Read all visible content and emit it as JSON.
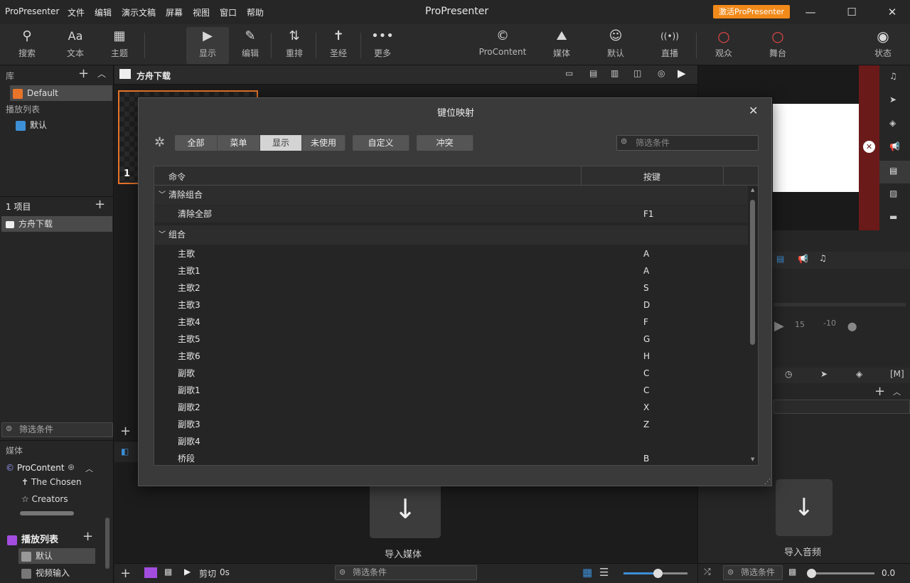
{
  "app": {
    "name": "ProPresenter",
    "title": "ProPresenter",
    "menu": [
      "文件",
      "编辑",
      "演示文稿",
      "屏幕",
      "视图",
      "窗口",
      "帮助"
    ],
    "activate_label": "激活ProPresenter"
  },
  "toolbar": {
    "left": [
      {
        "icon": "search-icon",
        "glyph": "🔍",
        "label": "搜索"
      },
      {
        "icon": "text-icon",
        "glyph": "Aa",
        "label": "文本"
      },
      {
        "icon": "theme-icon",
        "glyph": "▦",
        "label": "主题"
      }
    ],
    "mid": [
      {
        "icon": "play-icon",
        "glyph": "▶",
        "label": "显示"
      },
      {
        "icon": "edit-icon",
        "glyph": "✎",
        "label": "编辑"
      },
      {
        "icon": "reflow-icon",
        "glyph": "⇅",
        "label": "重排"
      },
      {
        "icon": "bible-icon",
        "glyph": "✝",
        "label": "圣经"
      },
      {
        "icon": "more-icon",
        "glyph": "•••",
        "label": "更多"
      }
    ],
    "right": [
      {
        "icon": "procontent-icon",
        "glyph": "©",
        "label": "ProContent"
      },
      {
        "icon": "media-icon",
        "glyph": "⛰",
        "label": "媒体"
      },
      {
        "icon": "default-icon",
        "glyph": "☺",
        "label": "默认"
      },
      {
        "icon": "live-icon",
        "glyph": "((•))",
        "label": "直播"
      },
      {
        "icon": "audience-icon",
        "glyph": "○",
        "label": "观众"
      },
      {
        "icon": "stage-icon",
        "glyph": "○",
        "label": "舞台"
      },
      {
        "icon": "status-icon",
        "glyph": "◉",
        "label": "状态"
      }
    ]
  },
  "library": {
    "title": "库",
    "item": "Default",
    "playlist_title": "播放列表",
    "playlist_item": "默认"
  },
  "items": {
    "title": "1 项目",
    "item": "方舟下载"
  },
  "left_filter": "筛选条件",
  "media": {
    "title": "媒体",
    "procontent": "ProContent",
    "sub": [
      "The Chosen",
      "Creators"
    ],
    "playlist_title": "播放列表",
    "playlist_items": [
      "默认",
      "视频输入"
    ]
  },
  "center": {
    "doc_title": "方舟下载",
    "slide_num": "1",
    "import_media": "导入媒体",
    "cut_label": "剪切",
    "cut_time": "0s",
    "filter": "筛选条件"
  },
  "right": {
    "import_audio": "导入音频",
    "filter": "筛选条件",
    "volume": "0.0",
    "skip_fwd": "15",
    "skip_back": "-10"
  },
  "dialog": {
    "title": "键位映射",
    "tabs": [
      "全部",
      "菜单",
      "显示",
      "未使用"
    ],
    "selected_tab": "显示",
    "custom": "自定义",
    "conflict": "冲突",
    "filter_placeholder": "筛选条件",
    "col_command": "命令",
    "col_key": "按键",
    "rows": [
      {
        "type": "group",
        "cmd": "清除组合",
        "key": ""
      },
      {
        "type": "item",
        "cmd": "清除全部",
        "key": "F1"
      },
      {
        "type": "group",
        "cmd": "组合",
        "key": ""
      },
      {
        "type": "item",
        "cmd": "主歌",
        "key": "A"
      },
      {
        "type": "item",
        "cmd": "主歌1",
        "key": "A"
      },
      {
        "type": "item",
        "cmd": "主歌2",
        "key": "S"
      },
      {
        "type": "item",
        "cmd": "主歌3",
        "key": "D"
      },
      {
        "type": "item",
        "cmd": "主歌4",
        "key": "F"
      },
      {
        "type": "item",
        "cmd": "主歌5",
        "key": "G"
      },
      {
        "type": "item",
        "cmd": "主歌6",
        "key": "H"
      },
      {
        "type": "item",
        "cmd": "副歌",
        "key": "C"
      },
      {
        "type": "item",
        "cmd": "副歌1",
        "key": "C"
      },
      {
        "type": "item",
        "cmd": "副歌2",
        "key": "X"
      },
      {
        "type": "item",
        "cmd": "副歌3",
        "key": "Z"
      },
      {
        "type": "item",
        "cmd": "副歌4",
        "key": ""
      },
      {
        "type": "item",
        "cmd": "桥段",
        "key": "B"
      }
    ]
  }
}
